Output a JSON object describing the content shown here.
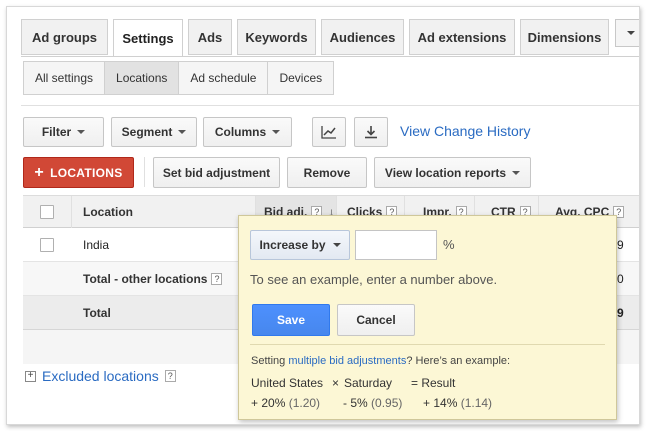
{
  "tabs": [
    {
      "label": "Ad groups",
      "active": false
    },
    {
      "label": "Settings",
      "active": true
    },
    {
      "label": "Ads",
      "active": false
    },
    {
      "label": "Keywords",
      "active": false
    },
    {
      "label": "Audiences",
      "active": false
    },
    {
      "label": "Ad extensions",
      "active": false
    },
    {
      "label": "Dimensions",
      "active": false
    }
  ],
  "subtabs": [
    {
      "label": "All settings",
      "active": false
    },
    {
      "label": "Locations",
      "active": true
    },
    {
      "label": "Ad schedule",
      "active": false
    },
    {
      "label": "Devices",
      "active": false
    }
  ],
  "toolbar": {
    "filter": "Filter",
    "segment": "Segment",
    "columns": "Columns",
    "view_change_history": "View Change History"
  },
  "actions": {
    "add_locations": "LOCATIONS",
    "set_bid_adjustment": "Set bid adjustment",
    "remove": "Remove",
    "view_location_reports": "View location reports"
  },
  "table": {
    "headers": {
      "location": "Location",
      "bid_adj": "Bid adj.",
      "clicks": "Clicks",
      "impr": "Impr.",
      "ctr": "CTR",
      "avg_cpc": "Avg. CPC"
    },
    "help_mark": "?",
    "rows": [
      {
        "location": "India",
        "avg_cpc_partial": "9"
      },
      {
        "location": "Total - other locations",
        "avg_cpc_partial": "0"
      },
      {
        "location": "Total",
        "avg_cpc_partial": "9"
      }
    ]
  },
  "excluded": {
    "label": "Excluded locations",
    "expand": "+"
  },
  "popup": {
    "mode": "Increase by",
    "input_value": "",
    "percent": "%",
    "hint": "To see an example, enter a number above.",
    "save": "Save",
    "cancel": "Cancel",
    "note_prefix": "Setting ",
    "note_link": "multiple bid adjustments",
    "note_suffix": "? Here’s an example:",
    "example": {
      "a": "United States",
      "times": "×",
      "b": "Saturday",
      "eq": "= Result",
      "a_val": "+ 20%",
      "a_paren": "(1.20)",
      "b_val": "- 5%",
      "b_paren": "(0.95)",
      "r_val": "+ 14%",
      "r_paren": "(1.14)"
    }
  },
  "colors": {
    "accent_red": "#d14836",
    "accent_blue": "#4d90fe",
    "link": "#2a6bc2",
    "popup_bg": "#fcf7d5"
  }
}
